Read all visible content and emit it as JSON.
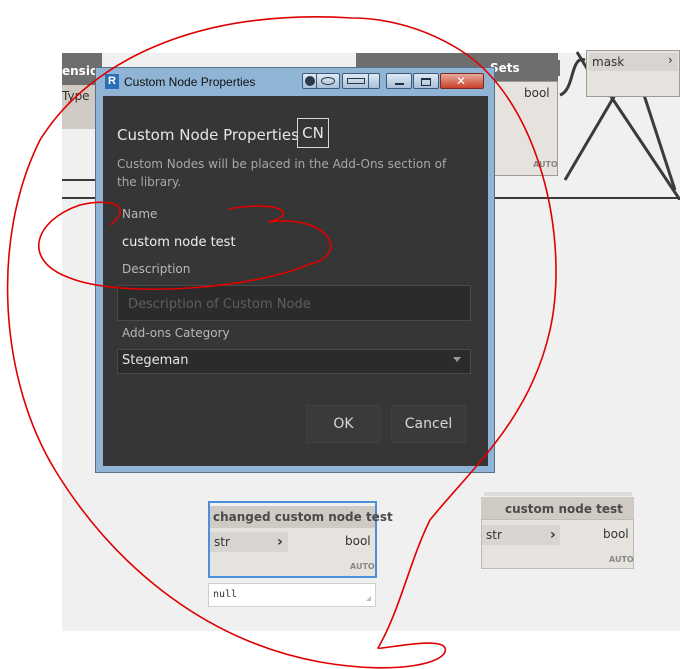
{
  "nodes": {
    "top_left": {
      "title": "ension",
      "port": "Type"
    },
    "top_middle": {
      "title": "Sets Contains",
      "port": "bool",
      "auto": "AUTO"
    },
    "top_right": {
      "port": "mask"
    },
    "selected": {
      "title": "changed custom node test",
      "in_port": "str",
      "out_port": "bool",
      "auto": "AUTO"
    },
    "right": {
      "title": "custom node test",
      "in_port": "str",
      "out_port": "bool",
      "auto": "AUTO"
    }
  },
  "watch": {
    "value": "null"
  },
  "dialog": {
    "window_title": "Custom Node Properties",
    "app_icon": "R",
    "heading": "Custom Node Properties",
    "badge": "CN",
    "description": "Custom Nodes will be placed in the Add-Ons section of the library.",
    "name_label": "Name",
    "name_value": "custom node test",
    "description_label": "Description",
    "description_placeholder": "Description of Custom Node",
    "category_label": "Add-ons Category",
    "category_value": "Stegeman",
    "ok_label": "OK",
    "cancel_label": "Cancel"
  },
  "colors": {
    "annotation": "#e00000",
    "dialog_bg": "#363636",
    "node_title": "#6e6e6e",
    "selection": "#4b8fd6"
  }
}
